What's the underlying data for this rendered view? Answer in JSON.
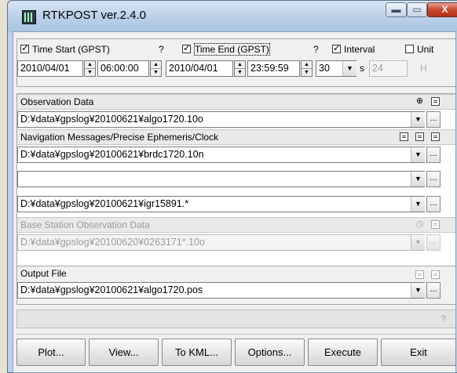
{
  "window": {
    "title": "RTKPOST ver.2.4.0",
    "min": "▬",
    "max": "▭",
    "close": "X"
  },
  "time": {
    "start_label": "Time Start (GPST)",
    "start_help": "?",
    "start_checked": true,
    "start_date": "2010/04/01",
    "start_time": "06:00:00",
    "end_label": "Time End (GPST)",
    "end_help": "?",
    "end_checked": true,
    "end_date": "2010/04/01",
    "end_time": "23:59:59",
    "interval_label": "Interval",
    "interval_checked": true,
    "interval_value": "30",
    "interval_unit": "s",
    "unit_label": "Unit",
    "unit_checked": false,
    "unit_value": "24",
    "unit_suffix": "H"
  },
  "observation": {
    "label": "Observation Data",
    "path": "D:¥data¥gpslog¥20100621¥algo1720.10o"
  },
  "navigation": {
    "label": "Navigation Messages/Precise Ephemeris/Clock",
    "path1": "D:¥data¥gpslog¥20100621¥brdc1720.10n",
    "path2": "",
    "path3": "D:¥data¥gpslog¥20100621¥igr15891.*"
  },
  "base": {
    "label": "Base Station Observation Data",
    "path": "D:¥data¥gpslog¥20100620¥0263171*.10o"
  },
  "output": {
    "label": "Output File",
    "path": "D:¥data¥gpslog¥20100621¥algo1720.pos"
  },
  "status": {
    "help": "?"
  },
  "buttons": {
    "plot": "Plot...",
    "view": "View...",
    "kml": "To KML...",
    "options": "Options...",
    "execute": "Execute",
    "exit": "Exit"
  },
  "glyphs": {
    "ellipsis": "...",
    "dropdown": "▼",
    "up": "▲",
    "down": "▼"
  },
  "colors": {
    "title_gradient_top": "#d7e6f5",
    "close_button": "#c8462e",
    "client_bg": "#f0f0f0"
  }
}
